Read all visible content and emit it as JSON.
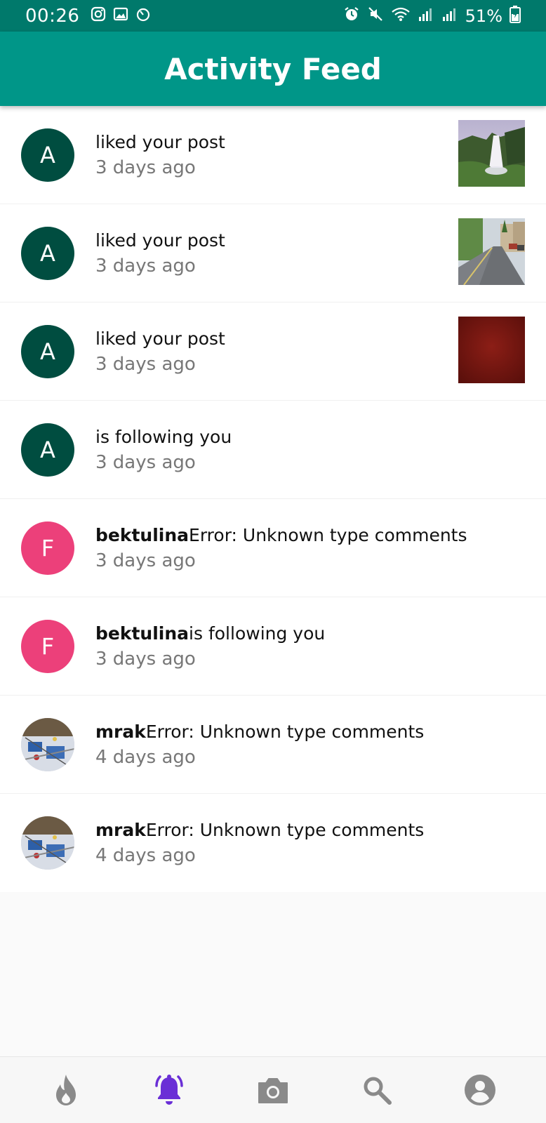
{
  "status_bar": {
    "time": "00:26",
    "battery": "51%"
  },
  "header": {
    "title": "Activity Feed"
  },
  "colors": {
    "status_bar": "#00796b",
    "app_bar": "#009688",
    "avatar_dark_green": "#004d40",
    "avatar_pink": "#ec407a",
    "nav_active": "#6a2fd6",
    "nav_inactive": "#8a8a8a"
  },
  "feed": [
    {
      "avatar": "A",
      "username": "",
      "message": "liked your post",
      "time": "3 days ago",
      "thumbnail": "waterfall"
    },
    {
      "avatar": "A",
      "username": "",
      "message": "liked your post",
      "time": "3 days ago",
      "thumbnail": "street"
    },
    {
      "avatar": "A",
      "username": "",
      "message": "liked your post",
      "time": "3 days ago",
      "thumbnail": "red-texture"
    },
    {
      "avatar": "A",
      "username": "",
      "message": "is following you",
      "time": "3 days ago"
    },
    {
      "avatar": "F",
      "username": "bektulina",
      "message": "Error: Unknown type comments",
      "time": "3 days ago"
    },
    {
      "avatar": "F",
      "username": "bektulina",
      "message": "is following you",
      "time": "3 days ago"
    },
    {
      "avatar": "photo",
      "username": "mrak",
      "message": "Error: Unknown type comments",
      "time": "4 days ago"
    },
    {
      "avatar": "photo",
      "username": "mrak",
      "message": "Error: Unknown type comments",
      "time": "4 days ago"
    }
  ],
  "bottom_nav": {
    "items": [
      {
        "icon": "flame-icon",
        "active": false
      },
      {
        "icon": "bell-icon",
        "active": true
      },
      {
        "icon": "camera-icon",
        "active": false
      },
      {
        "icon": "search-icon",
        "active": false
      },
      {
        "icon": "account-icon",
        "active": false
      }
    ]
  }
}
